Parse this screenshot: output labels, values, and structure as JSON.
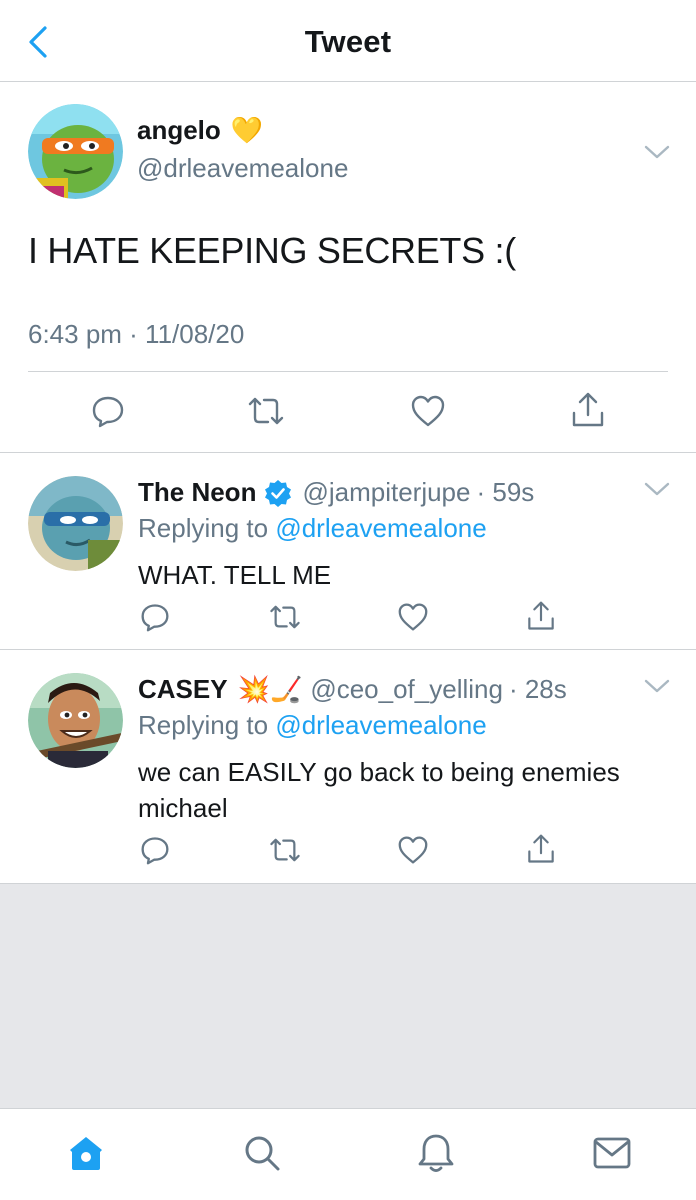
{
  "header": {
    "title": "Tweet"
  },
  "main_tweet": {
    "name": "angelo",
    "name_emoji": "💛",
    "handle": "@drleavemealone",
    "text": "I HATE KEEPING SECRETS :(",
    "timestamp": "6:43 pm · 11/08/20"
  },
  "replies": [
    {
      "name": "The Neon",
      "verified": true,
      "handle": "@jampiterjupe",
      "time": "· 59s",
      "replying_prefix": "Replying to ",
      "replying_to": "@drleavemealone",
      "text": "WHAT. TELL ME"
    },
    {
      "name": "CASEY",
      "name_emoji": "💥🏒",
      "handle": "@ceo_of_yelling",
      "time": "· 28s",
      "replying_prefix": "Replying to ",
      "replying_to": "@drleavemealone",
      "text": "we can EASILY go back to being enemies michael"
    }
  ],
  "colors": {
    "accent": "#1da1f2",
    "muted": "#657786",
    "text": "#14171a",
    "divider": "#d0d3d6",
    "empty_bg": "#e6e7ea"
  },
  "icons": {
    "header": [
      "back-icon"
    ],
    "actions": [
      "reply-icon",
      "retweet-icon",
      "like-icon",
      "share-icon"
    ],
    "tabs": [
      "home-icon",
      "search-icon",
      "notifications-icon",
      "messages-icon"
    ]
  }
}
